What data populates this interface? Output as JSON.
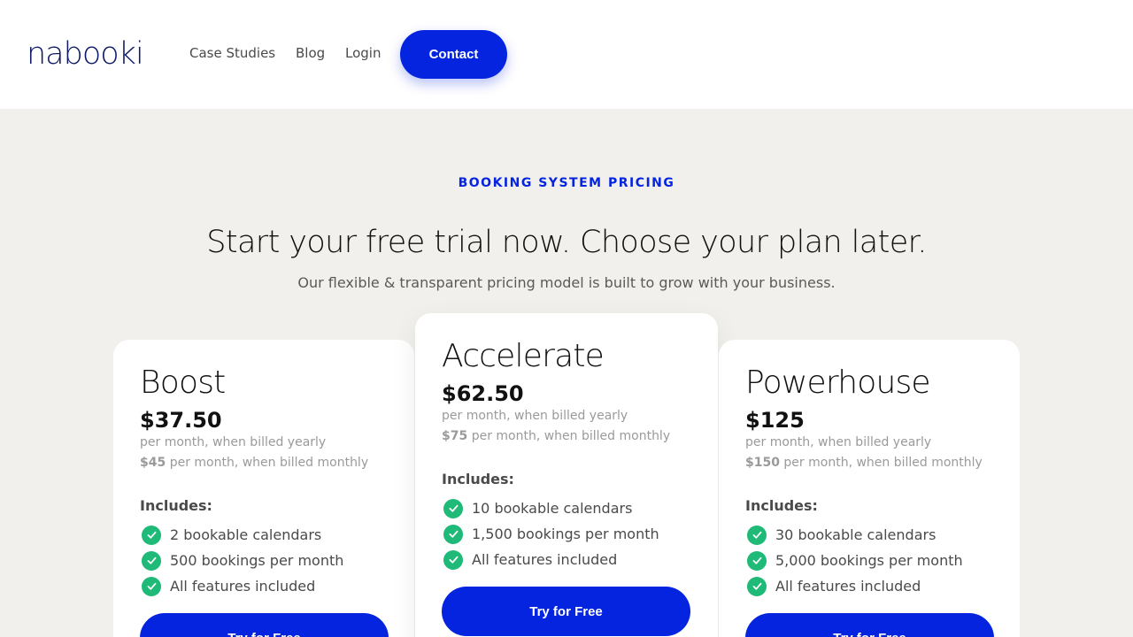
{
  "brand": {
    "logo_text": "nabooki",
    "logo_color": "#0c1a66"
  },
  "nav": {
    "case_studies": "Case Studies",
    "blog": "Blog",
    "login": "Login",
    "contact": "Contact"
  },
  "hero": {
    "eyebrow": "BOOKING SYSTEM PRICING",
    "headline": "Start your free trial now. Choose your plan later.",
    "subhead": "Our flexible & transparent pricing model is built to grow with your business."
  },
  "plans": [
    {
      "name": "Boost",
      "price": "$37.50",
      "yearly": "per month, when billed yearly",
      "monthly_price": "$45",
      "monthly_label": "per month, when billed monthly",
      "includes": "Includes:",
      "features": [
        "2 bookable calendars",
        "500 bookings per month",
        "All features included"
      ],
      "cta": "Try for Free"
    },
    {
      "name": "Accelerate",
      "price": "$62.50",
      "yearly": "per month, when billed yearly",
      "monthly_price": "$75",
      "monthly_label": "per month, when billed monthly",
      "includes": "Includes:",
      "features": [
        "10 bookable calendars",
        "1,500 bookings per month",
        "All features included"
      ],
      "cta": "Try for Free"
    },
    {
      "name": "Powerhouse",
      "price": "$125",
      "yearly": "per month, when billed yearly",
      "monthly_price": "$150",
      "monthly_label": "per month, when billed monthly",
      "includes": "Includes:",
      "features": [
        "30 bookable calendars",
        "5,000 bookings per month",
        "All features included"
      ],
      "cta": "Try for Free"
    }
  ],
  "colors": {
    "accent": "#0424e0",
    "check": "#1fb978",
    "background": "#f1f0ec"
  },
  "icons": {
    "feature_check": "check-circle-icon"
  }
}
